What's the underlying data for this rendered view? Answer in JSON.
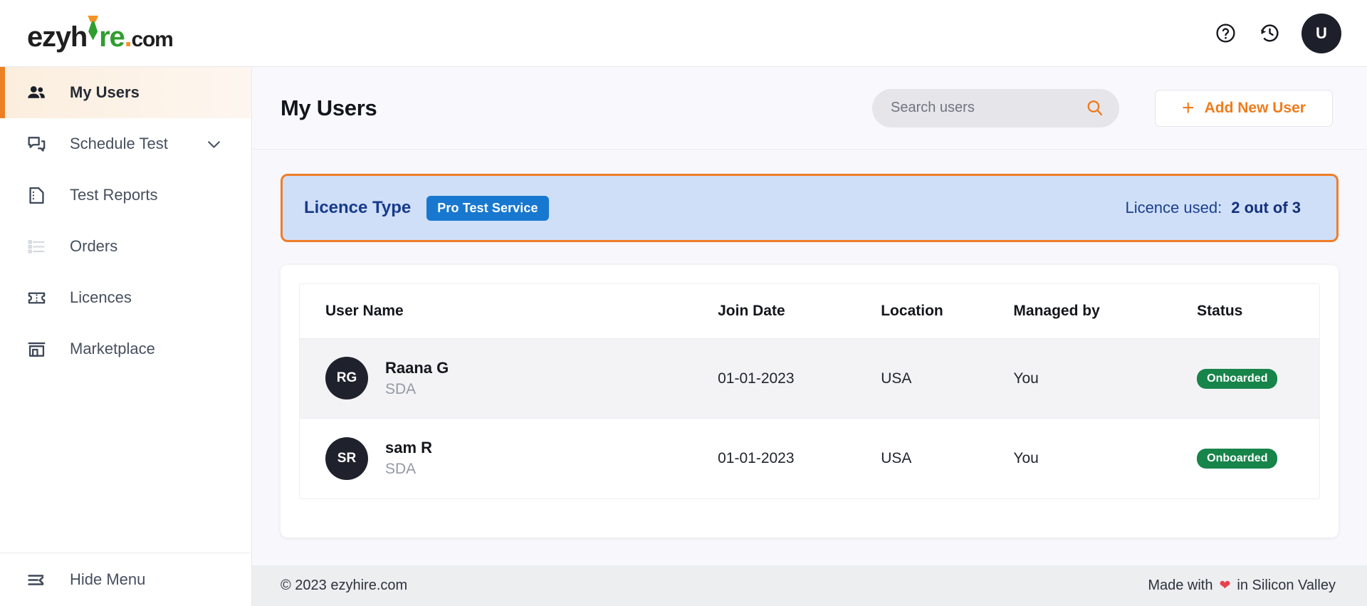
{
  "brand": {
    "name_part1": "ezyh",
    "name_part2": "r",
    "name_part3": "e",
    "dot": ".",
    "suffix": "com"
  },
  "topbar": {
    "help_icon": "help-circle-icon",
    "history_icon": "history-clock-icon",
    "avatar_initial": "U"
  },
  "sidebar": {
    "items": [
      {
        "label": "My Users",
        "icon": "people-icon",
        "active": true
      },
      {
        "label": "Schedule Test",
        "icon": "chat-bubble-icon",
        "active": false,
        "chevron": "chevron-down-icon"
      },
      {
        "label": "Test Reports",
        "icon": "document-icon",
        "active": false
      },
      {
        "label": "Orders",
        "icon": "list-icon",
        "active": false
      },
      {
        "label": "Licences",
        "icon": "ticket-icon",
        "active": false
      },
      {
        "label": "Marketplace",
        "icon": "store-icon",
        "active": false
      }
    ],
    "hide_menu": {
      "label": "Hide Menu",
      "icon": "collapse-menu-icon"
    }
  },
  "page": {
    "title": "My Users"
  },
  "search": {
    "placeholder": "Search users",
    "value": "",
    "icon": "search-icon"
  },
  "add_user_button": {
    "label": "Add New User",
    "icon": "plus-icon"
  },
  "licence_banner": {
    "label": "Licence Type",
    "type_badge": "Pro Test Service",
    "used_label": "Licence used:",
    "used_value": "2 out of 3",
    "border_color": "#f07d28",
    "background_color": "#cfdff8",
    "badge_color": "#1878cf"
  },
  "table": {
    "columns": [
      "User Name",
      "Join Date",
      "Location",
      "Managed by",
      "Status"
    ],
    "rows": [
      {
        "initials": "RG",
        "name": "Raana G",
        "role": "SDA",
        "join_date": "01-01-2023",
        "location": "USA",
        "managed_by": "You",
        "status": "Onboarded",
        "status_color": "#17844a"
      },
      {
        "initials": "SR",
        "name": "sam R",
        "role": "SDA",
        "join_date": "01-01-2023",
        "location": "USA",
        "managed_by": "You",
        "status": "Onboarded",
        "status_color": "#17844a"
      }
    ]
  },
  "footer": {
    "copyright": "© 2023 ezyhire.com",
    "made_prefix": "Made with",
    "heart_icon": "heart-icon",
    "made_suffix": "in Silicon Valley"
  }
}
